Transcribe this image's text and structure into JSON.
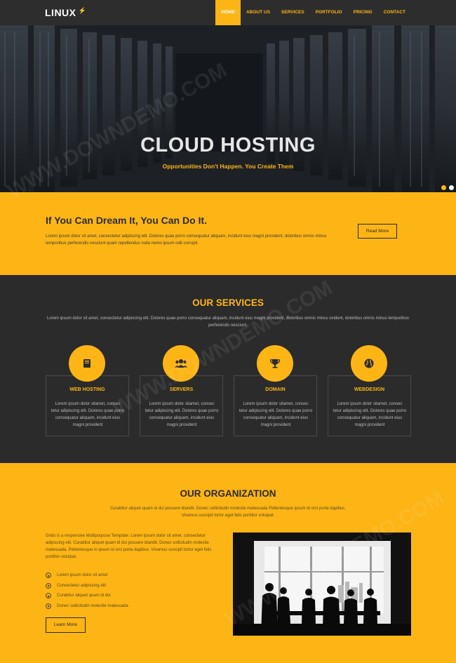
{
  "nav": {
    "logo": "LINUX",
    "items": [
      "HOME",
      "ABOUT US",
      "SERVICES",
      "PORTFOLIO",
      "PRICING",
      "CONTACT"
    ]
  },
  "hero": {
    "title": "CLOUD HOSTING",
    "subtitle": "Opportunities Don't Happen. You Create Them"
  },
  "dream": {
    "title": "If You Can Dream It, You Can Do It.",
    "text": "Lorem ipsum dolor sit amet, consectetur adipiscing elit. Dolores quae porro consequatur aliquam, incidunt eius magni provident, doloribus omnis minus temporibus perferendis nesciunt quam repellendus nulla nemo ipsum odit corrupti.",
    "button": "Read More"
  },
  "services": {
    "title": "OUR SERVICES",
    "intro": "Lorem ipsum dolor sit amet, consectetur adipiscing elit. Dolores quae porro consequatur aliquam, incidunt eius magni provident, doloribus omnis minus ovident, doloribus omnis minus temporibus perferendis nesciunt.",
    "cards": [
      {
        "title": "WEB HOSTING",
        "text": "Lorem ipsum dolor sitamet, consec tetur adipiscing elit. Dolores quae porro consequatur aliquam, incidunt eius magni provident",
        "icon": "book-icon"
      },
      {
        "title": "SERVERS",
        "text": "Lorem ipsum dolor sitamet, consec tetur adipiscing elit. Dolores quae porro consequatur aliquam, incidunt eius magni provident",
        "icon": "users-icon"
      },
      {
        "title": "DOMAIN",
        "text": "Lorem ipsum dolor sitamet, consec tetur adipiscing elit. Dolores quae porro consequatur aliquam, incidunt eius magni provident",
        "icon": "trophy-icon"
      },
      {
        "title": "WEBDESIGN",
        "text": "Lorem ipsum dolor sitamet, consec tetur adipiscing elit. Dolores quae porro consequatur aliquam, incidunt eius magni provident",
        "icon": "globe-icon"
      }
    ]
  },
  "org": {
    "title": "OUR ORGANIZATION",
    "intro": "Curabitur aliquet quam id dui posuere blandit. Donec sollicitudin molestie malesuada Pellentesque ipsum id orci porta dapibus. Vivamus suscipit tortor eget felis porttitor volutpat.",
    "para": "Grids is a responsive Multipurpose Template. Lorem ipsum dolor sit amet, consectetur adipiscing elit. Curabitur aliquet quam id dui posuere blandit. Donec sollicitudin molestie malesuada. Pellentesque in ipsum id orci porta dapibus. Vivamus suscipit tortor eget felis porttitor volutpat.",
    "list": [
      "Lorem ipsum dolor sit amet",
      "Consectetur adipiscing elit",
      "Curabitur aliquet quam id dui",
      "Donec sollicitudin molestie malesuada"
    ],
    "button": "Learn More"
  },
  "watermark": "WWW.DOWNDEMO.COM",
  "colors": {
    "accent": "#fdb515",
    "dark": "#2b2b2b"
  }
}
